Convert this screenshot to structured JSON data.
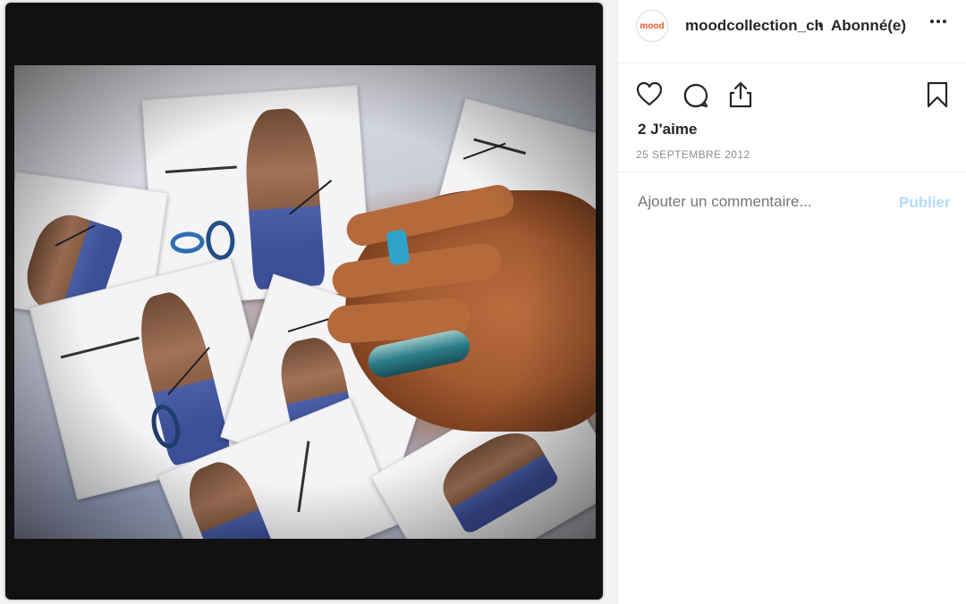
{
  "post": {
    "image_alt": "Photo of signed mood collection promotional cards with a hand holding a pen"
  },
  "header": {
    "avatar_text": "mood",
    "username": "moodcollection_ch",
    "separator": "•",
    "follow_status": "Abonné(e)",
    "more_label": "•••"
  },
  "actions": {
    "like_icon": "heart-icon",
    "comment_icon": "comment-icon",
    "share_icon": "share-icon",
    "save_icon": "bookmark-icon"
  },
  "likes_text": "2 J'aime",
  "date_text": "25 SEPTEMBRE 2012",
  "comment": {
    "placeholder": "Ajouter un commentaire...",
    "publish_label": "Publier"
  },
  "colors": {
    "publish_disabled": "#b3dbff",
    "text_primary": "#262626",
    "text_secondary": "#8e8e8e"
  }
}
